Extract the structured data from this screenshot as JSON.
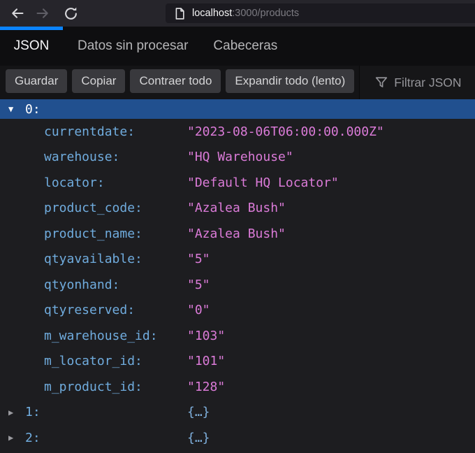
{
  "browser": {
    "url_host": "localhost",
    "url_rest": ":3000/products"
  },
  "tabs": [
    {
      "label": "JSON"
    },
    {
      "label": "Datos sin procesar"
    },
    {
      "label": "Cabeceras"
    }
  ],
  "toolbar": {
    "buttons": [
      {
        "label": "Guardar"
      },
      {
        "label": "Copiar"
      },
      {
        "label": "Contraer todo"
      },
      {
        "label": "Expandir todo (lento)"
      }
    ],
    "filter_placeholder": "Filtrar JSON"
  },
  "icons": {
    "expanded": "▼",
    "collapsed": "▶"
  },
  "tree": {
    "root": {
      "label": "0:"
    },
    "entries": [
      {
        "key": "currentdate:",
        "value": "\"2023-08-06T06:00:00.000Z\""
      },
      {
        "key": "warehouse:",
        "value": "\"HQ Warehouse\""
      },
      {
        "key": "locator:",
        "value": "\"Default HQ Locator\""
      },
      {
        "key": "product_code:",
        "value": "\"Azalea Bush\""
      },
      {
        "key": "product_name:",
        "value": "\"Azalea Bush\""
      },
      {
        "key": "qtyavailable:",
        "value": "\"5\""
      },
      {
        "key": "qtyonhand:",
        "value": "\"5\""
      },
      {
        "key": "qtyreserved:",
        "value": "\"0\""
      },
      {
        "key": "m_warehouse_id:",
        "value": "\"103\""
      },
      {
        "key": "m_locator_id:",
        "value": "\"101\""
      },
      {
        "key": "m_product_id:",
        "value": "\"128\""
      }
    ],
    "collapsed_rows": [
      {
        "key": "1:",
        "value": "{…}"
      },
      {
        "key": "2:",
        "value": "{…}"
      }
    ]
  },
  "colors": {
    "accent-blue": "#0a84ff",
    "selected-row-blue": "#21508f",
    "key-blue": "#70acde",
    "string-pink": "#db7bd8",
    "object-summary-blue": "#7fb0dd"
  }
}
